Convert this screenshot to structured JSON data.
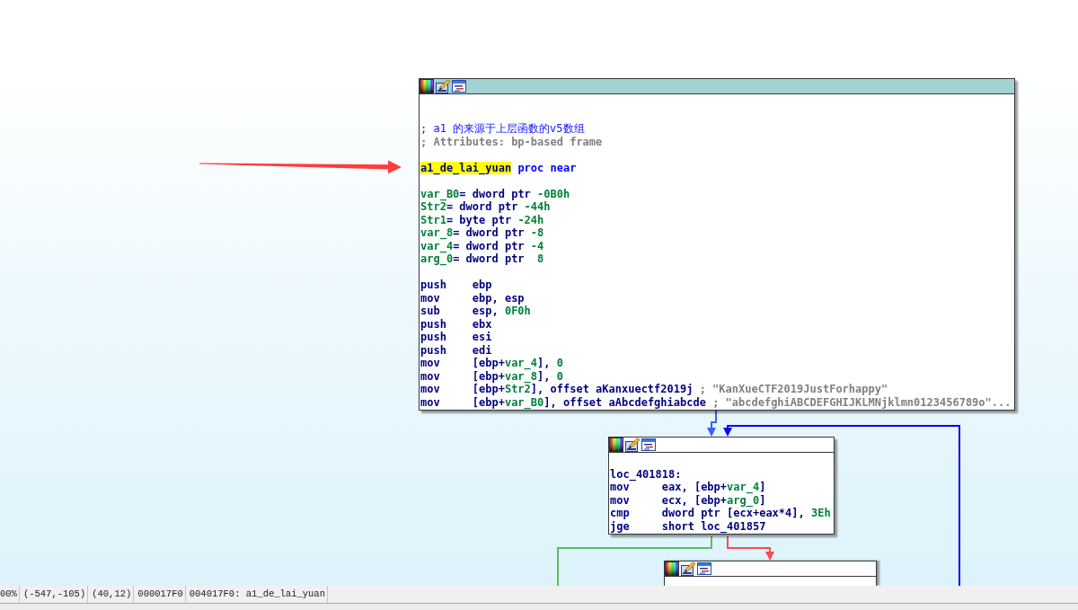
{
  "graph": {
    "nodes": [
      {
        "selected": true,
        "lines": [
          {
            "kind": "blank"
          },
          {
            "kind": "blank"
          },
          {
            "kind": "code",
            "tokens": [
              {
                "kind": "user_comment",
                "text": "; a1 的来源于上层函数的v5数组"
              }
            ]
          },
          {
            "kind": "code",
            "tokens": [
              {
                "kind": "comment",
                "text": "; Attributes: bp-based frame"
              }
            ]
          },
          {
            "kind": "blank"
          },
          {
            "kind": "code",
            "tokens": [
              {
                "kind": "label",
                "text": "a1_de_lai_yuan",
                "highlighted": true
              },
              {
                "kind": "keyword",
                "text": " proc near"
              }
            ]
          },
          {
            "kind": "blank"
          },
          {
            "kind": "code",
            "tokens": [
              {
                "kind": "name",
                "text": "var_B0"
              },
              {
                "kind": "text",
                "text": "= dword ptr "
              },
              {
                "kind": "number",
                "text": "-0B0h"
              }
            ]
          },
          {
            "kind": "code",
            "tokens": [
              {
                "kind": "name",
                "text": "Str2"
              },
              {
                "kind": "text",
                "text": "= dword ptr "
              },
              {
                "kind": "number",
                "text": "-44h"
              }
            ]
          },
          {
            "kind": "code",
            "tokens": [
              {
                "kind": "name",
                "text": "Str1"
              },
              {
                "kind": "text",
                "text": "= byte ptr "
              },
              {
                "kind": "number",
                "text": "-24h"
              }
            ]
          },
          {
            "kind": "code",
            "tokens": [
              {
                "kind": "name",
                "text": "var_8"
              },
              {
                "kind": "text",
                "text": "= dword ptr "
              },
              {
                "kind": "number",
                "text": "-8"
              }
            ]
          },
          {
            "kind": "code",
            "tokens": [
              {
                "kind": "name",
                "text": "var_4"
              },
              {
                "kind": "text",
                "text": "= dword ptr "
              },
              {
                "kind": "number",
                "text": "-4"
              }
            ]
          },
          {
            "kind": "code",
            "tokens": [
              {
                "kind": "name",
                "text": "arg_0"
              },
              {
                "kind": "text",
                "text": "= dword ptr  "
              },
              {
                "kind": "number",
                "text": "8"
              }
            ]
          },
          {
            "kind": "blank"
          },
          {
            "kind": "code",
            "tokens": [
              {
                "kind": "mnemonic",
                "text": "push"
              },
              {
                "kind": "text",
                "text": "ebp"
              }
            ]
          },
          {
            "kind": "code",
            "tokens": [
              {
                "kind": "mnemonic",
                "text": "mov"
              },
              {
                "kind": "text",
                "text": "ebp, esp"
              }
            ]
          },
          {
            "kind": "code",
            "tokens": [
              {
                "kind": "mnemonic",
                "text": "sub"
              },
              {
                "kind": "text",
                "text": "esp, "
              },
              {
                "kind": "number",
                "text": "0F0h"
              }
            ]
          },
          {
            "kind": "code",
            "tokens": [
              {
                "kind": "mnemonic",
                "text": "push"
              },
              {
                "kind": "text",
                "text": "ebx"
              }
            ]
          },
          {
            "kind": "code",
            "tokens": [
              {
                "kind": "mnemonic",
                "text": "push"
              },
              {
                "kind": "text",
                "text": "esi"
              }
            ]
          },
          {
            "kind": "code",
            "tokens": [
              {
                "kind": "mnemonic",
                "text": "push"
              },
              {
                "kind": "text",
                "text": "edi"
              }
            ]
          },
          {
            "kind": "code",
            "tokens": [
              {
                "kind": "mnemonic",
                "text": "mov"
              },
              {
                "kind": "text",
                "text": "[ebp+"
              },
              {
                "kind": "name",
                "text": "var_4"
              },
              {
                "kind": "text",
                "text": "], "
              },
              {
                "kind": "number",
                "text": "0"
              }
            ]
          },
          {
            "kind": "code",
            "tokens": [
              {
                "kind": "mnemonic",
                "text": "mov"
              },
              {
                "kind": "text",
                "text": "[ebp+"
              },
              {
                "kind": "name",
                "text": "var_8"
              },
              {
                "kind": "text",
                "text": "], "
              },
              {
                "kind": "number",
                "text": "0"
              }
            ]
          },
          {
            "kind": "code",
            "tokens": [
              {
                "kind": "mnemonic",
                "text": "mov"
              },
              {
                "kind": "text",
                "text": "[ebp+"
              },
              {
                "kind": "name",
                "text": "Str2"
              },
              {
                "kind": "text",
                "text": "], offset aKanxuectf2019j "
              },
              {
                "kind": "comment",
                "text": "; \"KanXueCTF2019JustForhappy\""
              }
            ]
          },
          {
            "kind": "code",
            "tokens": [
              {
                "kind": "mnemonic",
                "text": "mov"
              },
              {
                "kind": "text",
                "text": "[ebp+"
              },
              {
                "kind": "name",
                "text": "var_B0"
              },
              {
                "kind": "text",
                "text": "], offset aAbcdefghiabcde "
              },
              {
                "kind": "comment",
                "text": "; \"abcdefghiABCDEFGHIJKLMNjklmn0123456789o\"..."
              }
            ]
          }
        ]
      },
      {
        "selected": false,
        "lines": [
          {
            "kind": "blank"
          },
          {
            "kind": "code",
            "tokens": [
              {
                "kind": "label",
                "text": "loc_401818:",
                "highlighted": false
              }
            ]
          },
          {
            "kind": "code",
            "tokens": [
              {
                "kind": "mnemonic",
                "text": "mov"
              },
              {
                "kind": "text",
                "text": "eax, [ebp+"
              },
              {
                "kind": "name",
                "text": "var_4"
              },
              {
                "kind": "text",
                "text": "]"
              }
            ]
          },
          {
            "kind": "code",
            "tokens": [
              {
                "kind": "mnemonic",
                "text": "mov"
              },
              {
                "kind": "text",
                "text": "ecx, [ebp+"
              },
              {
                "kind": "name",
                "text": "arg_0"
              },
              {
                "kind": "text",
                "text": "]"
              }
            ]
          },
          {
            "kind": "code",
            "tokens": [
              {
                "kind": "mnemonic",
                "text": "cmp"
              },
              {
                "kind": "text",
                "text": "dword ptr [ecx+eax*4], "
              },
              {
                "kind": "number",
                "text": "3Eh"
              }
            ]
          },
          {
            "kind": "code",
            "tokens": [
              {
                "kind": "mnemonic",
                "text": "jge"
              },
              {
                "kind": "text",
                "text": "short loc_401857"
              }
            ]
          }
        ]
      },
      {
        "selected": false
      }
    ],
    "edges": [
      {
        "color": "#3f5cff"
      },
      {
        "color": "#0000ff"
      },
      {
        "color": "#5cbf5c"
      },
      {
        "color": "#ff4a4a"
      }
    ]
  },
  "status_bar": {
    "fields": [
      "00%",
      "(-547,-105)",
      "(40,12)",
      "000017F0",
      "004017F0: a1_de_lai_yuan"
    ]
  }
}
